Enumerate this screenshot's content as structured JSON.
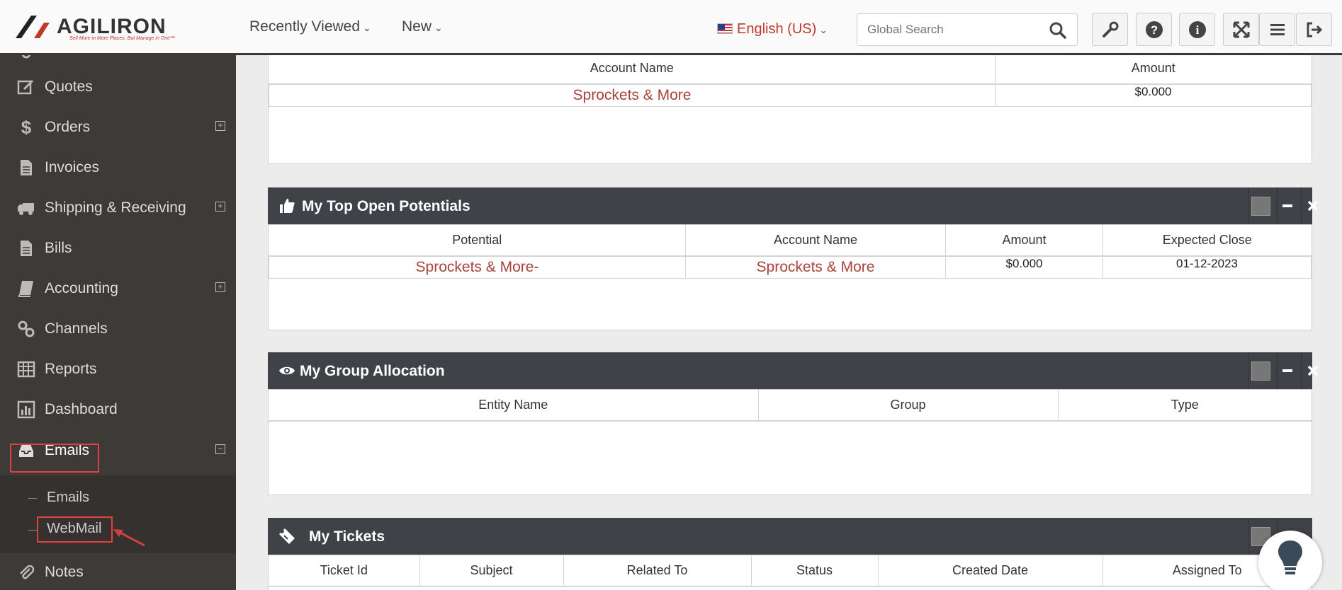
{
  "brand": {
    "name": "AGILIRON",
    "tagline": "Sell More in More Places. But Manage in One™"
  },
  "topbar": {
    "recently_viewed": "Recently Viewed",
    "new": "New",
    "language": "English (US)",
    "search_placeholder": "Global Search",
    "icons": [
      "wrench-icon",
      "help-icon",
      "info-icon",
      "expand-icon",
      "menu-icon",
      "logout-icon"
    ]
  },
  "sidebar": {
    "items": [
      {
        "label": "Quotes",
        "icon": "edit-icon"
      },
      {
        "label": "Orders",
        "icon": "dollar-icon",
        "expandable": true
      },
      {
        "label": "Invoices",
        "icon": "document-icon"
      },
      {
        "label": "Shipping & Receiving",
        "icon": "truck-icon",
        "expandable": true
      },
      {
        "label": "Bills",
        "icon": "document-icon"
      },
      {
        "label": "Accounting",
        "icon": "book-icon",
        "expandable": true
      },
      {
        "label": "Channels",
        "icon": "link-icon"
      },
      {
        "label": "Reports",
        "icon": "table-icon"
      },
      {
        "label": "Dashboard",
        "icon": "bar-chart-icon"
      },
      {
        "label": "Emails",
        "icon": "inbox-icon",
        "expanded": true
      },
      {
        "label": "Notes",
        "icon": "paperclip-icon"
      }
    ],
    "emails_submenu": [
      "Emails",
      "WebMail"
    ]
  },
  "panels": {
    "accounts": {
      "headers": [
        "Account Name",
        "Amount"
      ],
      "rows": [
        [
          "Sprockets & More",
          "$0.000"
        ]
      ]
    },
    "potentials": {
      "title": "My Top Open Potentials",
      "headers": [
        "Potential",
        "Account Name",
        "Amount",
        "Expected Close"
      ],
      "rows": [
        [
          "Sprockets & More-",
          "Sprockets & More",
          "$0.000",
          "01-12-2023"
        ]
      ]
    },
    "group_allocation": {
      "title": "My Group Allocation",
      "headers": [
        "Entity Name",
        "Group",
        "Type"
      ]
    },
    "tickets": {
      "title": "My Tickets",
      "headers": [
        "Ticket Id",
        "Subject",
        "Related To",
        "Status",
        "Created Date",
        "Assigned To"
      ]
    }
  },
  "colors": {
    "accent": "#c0392b",
    "sidebar_bg": "#3d3a37",
    "panel_header_bg": "#3f4247",
    "highlight_box": "#e04040"
  }
}
